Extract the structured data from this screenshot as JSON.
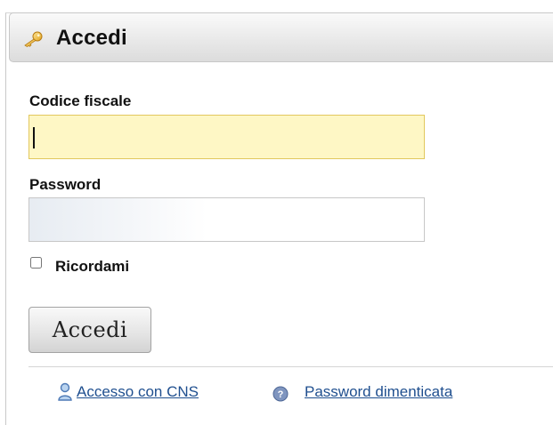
{
  "panel": {
    "title": "Accedi",
    "icon": "key-icon"
  },
  "form": {
    "codice_fiscale": {
      "label": "Codice fiscale",
      "value": ""
    },
    "password": {
      "label": "Password",
      "value": ""
    },
    "remember": {
      "label": "Ricordami",
      "checked": false
    },
    "submit_label": "Accedi"
  },
  "footer": {
    "cns_link": {
      "label": "Accesso con CNS",
      "icon": "user-icon"
    },
    "forgot_link": {
      "label": "Password dimenticata",
      "icon": "help-icon"
    }
  },
  "colors": {
    "focused_input_bg": "#fef7c5",
    "link": "#1f4f8f"
  }
}
